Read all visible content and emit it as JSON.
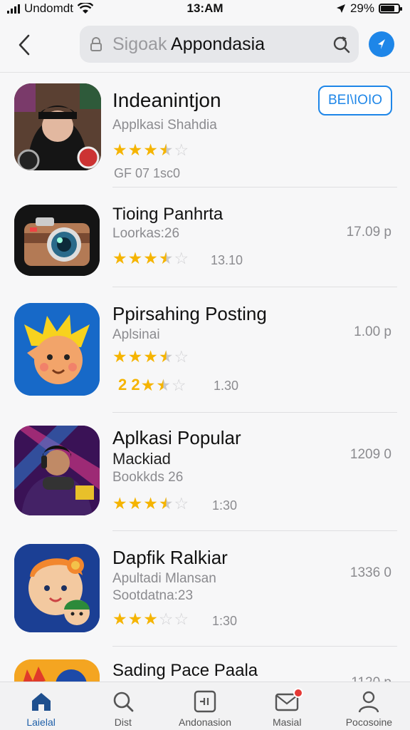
{
  "status_bar": {
    "carrier": "Undomdt",
    "time": "13:AM",
    "battery": "29%",
    "battery_level": 0.8
  },
  "header": {
    "search_hint": "Sigoak",
    "search_query": "Appondasia"
  },
  "apps": [
    {
      "title": "Indeanintjon",
      "subtitle": "Applkasi Shahdia",
      "rating": 3.5,
      "rating_label": "GF 07  1sc0",
      "action": "BEI\\IOIO",
      "icon": "portrait-hoodie-icon"
    },
    {
      "title": "Tioing Panhrta",
      "subtitle": "Loorkas:26",
      "rating": 3.5,
      "rating_label": "13.10",
      "price": "17.09 p",
      "icon": "camera-icon"
    },
    {
      "title": "Ppirsahing Posting",
      "subtitle": "Aplsinai",
      "rating": 3.5,
      "rating_label": "1.30",
      "extra_prefix": "2 2",
      "price": "1.00 p",
      "icon": "cartoon-character-icon"
    },
    {
      "title": "Aplkasi Popular",
      "subtitle_dark": "Mackiad",
      "subtitle": "Bookkds 26",
      "rating": 3.5,
      "rating_label": "1:30",
      "price": "1209 0",
      "icon": "gamer-character-icon"
    },
    {
      "title": "Dapfik Ralkiar",
      "subtitle": "Apultadi Mlansan",
      "subtitle2": "Sootdatna:23",
      "rating": 3.0,
      "rating_label": "1:30",
      "price": "1336 0",
      "icon": "kids-cartoon-icon"
    },
    {
      "title": "Sading Pace Paala",
      "price": "1120 p",
      "icon": "partial-app-icon"
    }
  ],
  "tabs": [
    {
      "label": "Laielal",
      "icon": "home-icon",
      "active": true
    },
    {
      "label": "Dist",
      "icon": "search-icon"
    },
    {
      "label": "Andonasion",
      "icon": "apps-icon"
    },
    {
      "label": "Masial",
      "icon": "mail-icon",
      "badge": true
    },
    {
      "label": "Pocosoine",
      "icon": "profile-icon"
    }
  ],
  "colors": {
    "accent": "#1e86e8",
    "star": "#f5b400",
    "badge": "#e53935"
  }
}
